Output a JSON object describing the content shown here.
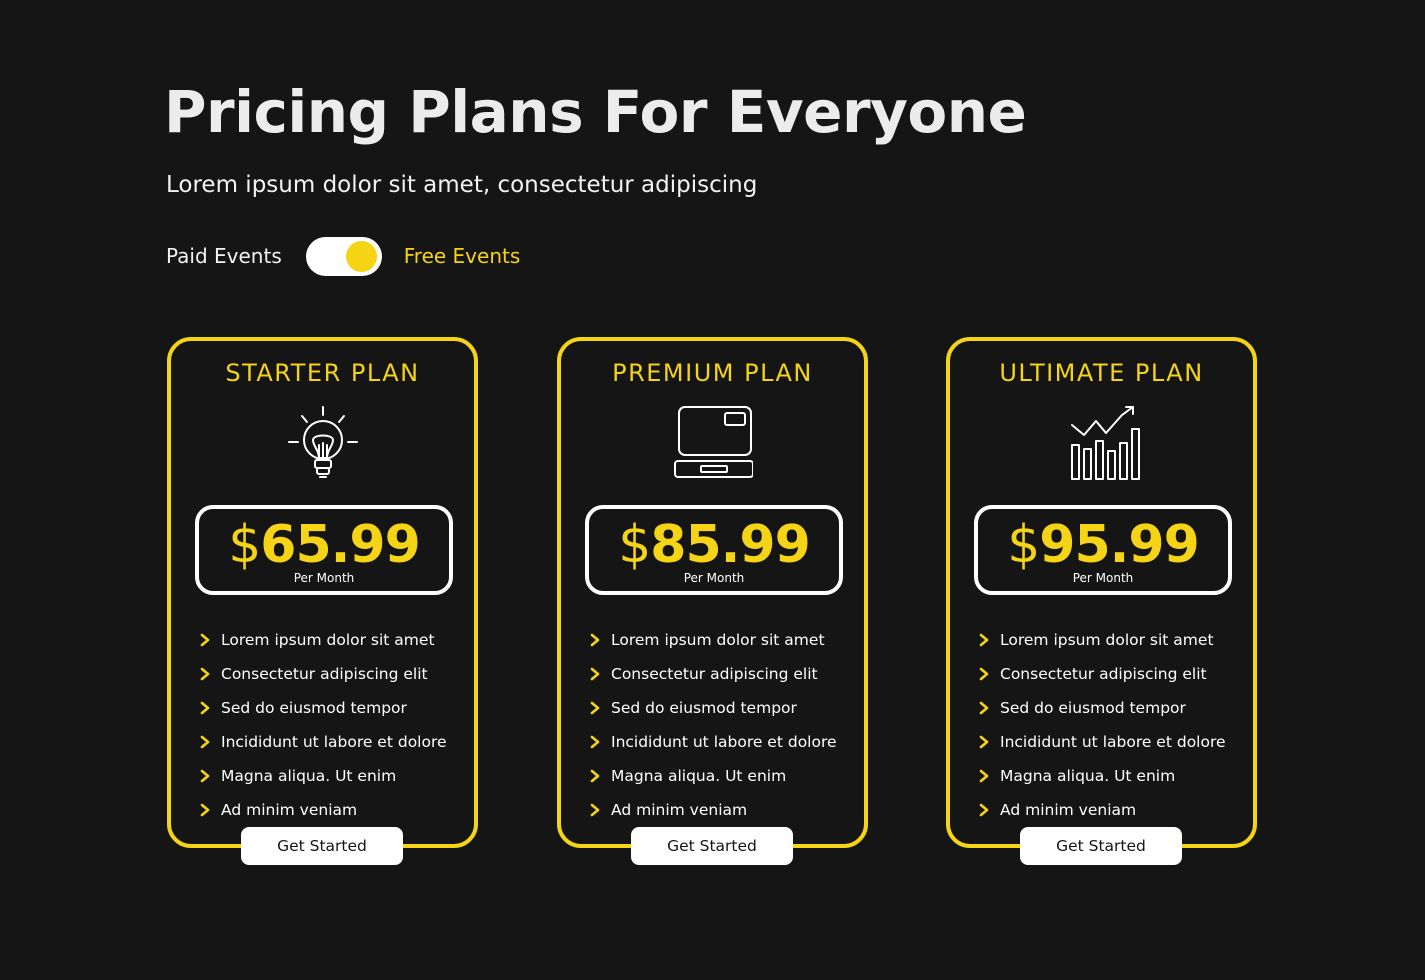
{
  "header": {
    "title": "Pricing Plans For Everyone",
    "subtitle": "Lorem ipsum dolor sit amet, consectetur adipiscing"
  },
  "toggle": {
    "left_label": "Paid Events",
    "right_label": "Free Events",
    "state": "on"
  },
  "colors": {
    "background": "#151515",
    "accent": "#f5d416",
    "text": "#ffffff"
  },
  "plans": [
    {
      "title": "STARTER PLAN",
      "icon": "lightbulb-icon",
      "currency": "$",
      "price": "65.99",
      "period": "Per Month",
      "features": [
        "Lorem ipsum dolor sit amet",
        "Consectetur adipiscing elit",
        "Sed do eiusmod tempor",
        "Incididunt ut labore et dolore",
        "Magna aliqua. Ut enim",
        "Ad minim veniam"
      ],
      "cta": "Get Started"
    },
    {
      "title": "PREMIUM PLAN",
      "icon": "computer-icon",
      "currency": "$",
      "price": "85.99",
      "period": "Per Month",
      "features": [
        "Lorem ipsum dolor sit amet",
        "Consectetur adipiscing elit",
        "Sed do eiusmod tempor",
        "Incididunt ut labore et dolore",
        "Magna aliqua. Ut enim",
        "Ad minim veniam"
      ],
      "cta": "Get Started"
    },
    {
      "title": "ULTIMATE PLAN",
      "icon": "growth-chart-icon",
      "currency": "$",
      "price": "95.99",
      "period": "Per Month",
      "features": [
        "Lorem ipsum dolor sit amet",
        "Consectetur adipiscing elit",
        "Sed do eiusmod tempor",
        "Incididunt ut labore et dolore",
        "Magna aliqua. Ut enim",
        "Ad minim veniam"
      ],
      "cta": "Get Started"
    }
  ]
}
